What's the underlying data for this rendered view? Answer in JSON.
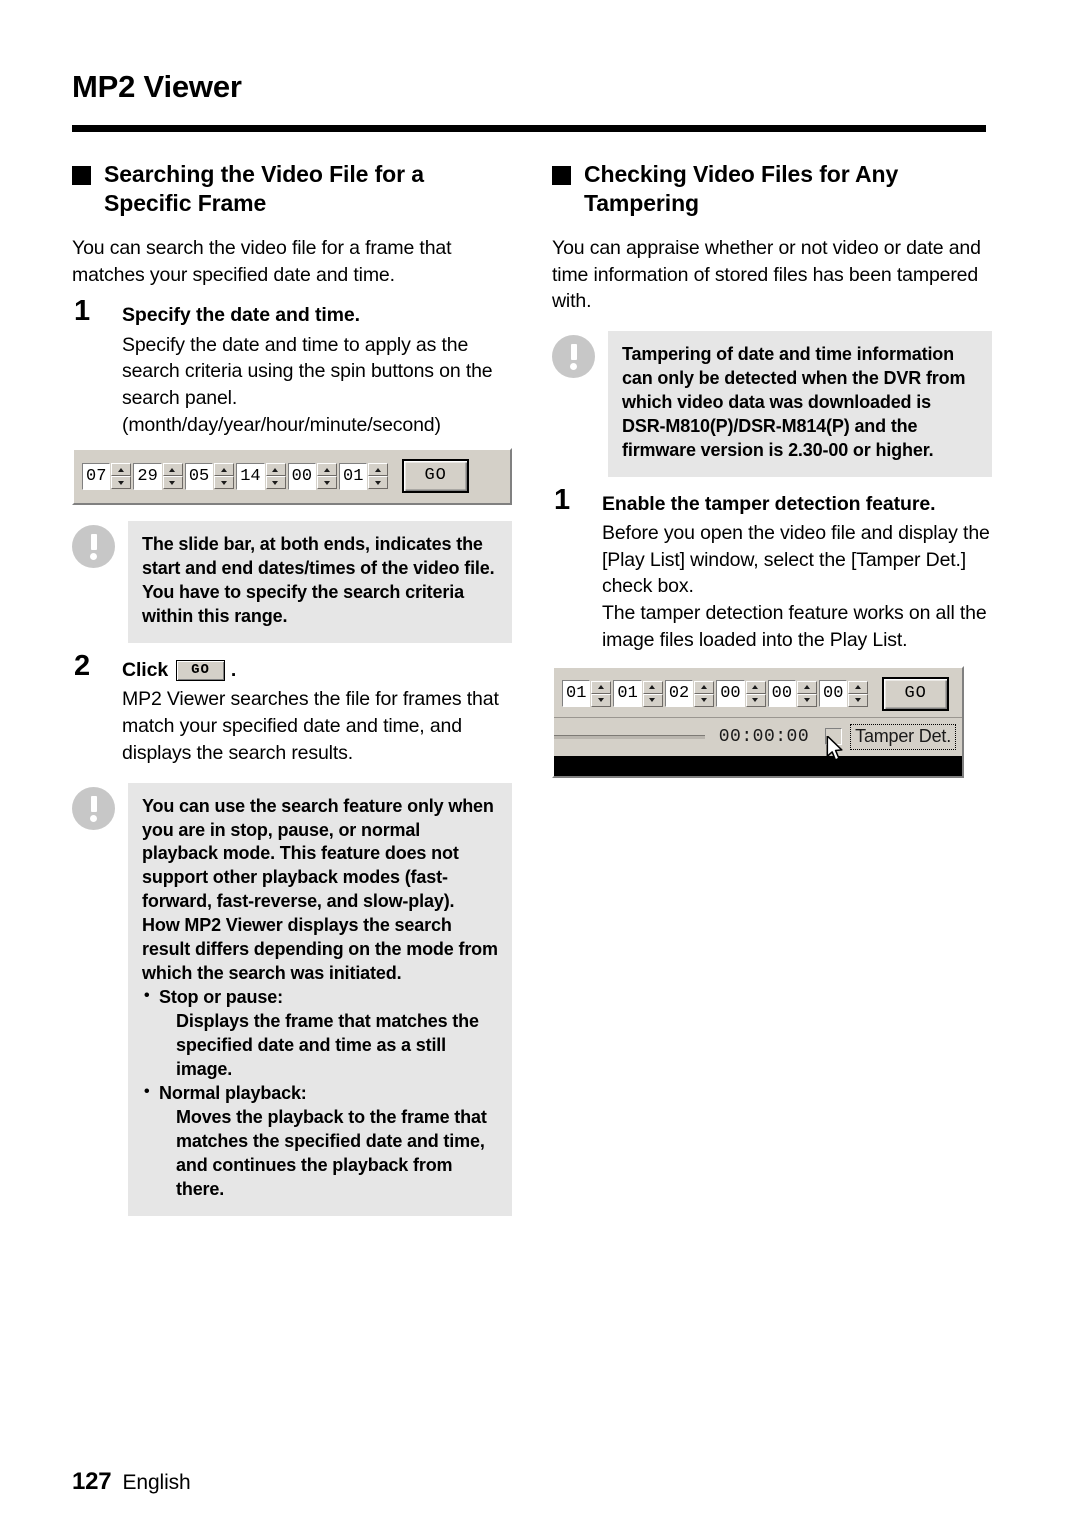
{
  "header": {
    "title": "MP2 Viewer"
  },
  "left_column": {
    "section_title": "Searching the Video File for a Specific Frame",
    "intro": "You can search the video file for a frame that matches your specified date and time.",
    "step1": {
      "number": "1",
      "title": "Specify the date and time.",
      "body": "Specify the date and time to apply as the search criteria using the spin buttons on the search panel. (month/day/year/hour/minute/second)"
    },
    "search_panel": {
      "spinners": [
        {
          "label": "month",
          "value": "07"
        },
        {
          "label": "day",
          "value": "29"
        },
        {
          "label": "year",
          "value": "05"
        },
        {
          "label": "hour",
          "value": "14"
        },
        {
          "label": "minute",
          "value": "00"
        },
        {
          "label": "second",
          "value": "01"
        }
      ],
      "go_label": "GO"
    },
    "note1": {
      "icon": "exclamation-circle-icon",
      "text": "The slide bar, at both ends, indicates the start and end dates/times of the video file. You have to specify the search criteria within this range."
    },
    "step2": {
      "number": "2",
      "title_prefix": "Click",
      "button_label": "GO",
      "title_suffix": ".",
      "body": "MP2 Viewer searches the file for frames that match your specified date and time, and displays the search results."
    },
    "note2": {
      "icon": "exclamation-circle-icon",
      "p1": "You can use the search feature only when you are in stop, pause, or normal playback mode. This feature does not support other playback modes (fast-forward, fast-reverse, and slow-play).",
      "p2": "How MP2 Viewer displays the search result differs depending on the mode from which the search was initiated.",
      "bullets": [
        {
          "term": "Stop or pause:",
          "detail": "Displays the frame that matches the specified date and time as a still image."
        },
        {
          "term": "Normal playback:",
          "detail": "Moves the playback to the frame that matches the specified date and time, and continues the playback from there."
        }
      ]
    }
  },
  "right_column": {
    "section_title": "Checking Video Files for Any Tampering",
    "intro": "You can appraise whether or not video or date and time information of stored files has been tampered with.",
    "note1": {
      "icon": "exclamation-circle-icon",
      "text": "Tampering of date and time information can only be detected when the DVR from which video data was downloaded is DSR-M810(P)/DSR-M814(P) and the firmware version is 2.30-00 or higher."
    },
    "step1": {
      "number": "1",
      "title": "Enable the tamper detection feature.",
      "body1": "Before you open the video file and display the [Play List] window, select the [Tamper Det.] check box.",
      "body2": "The tamper detection feature works on all the image files loaded into the Play List."
    },
    "tamper_panel": {
      "spinners": [
        {
          "label": "month",
          "value": "01"
        },
        {
          "label": "day",
          "value": "01"
        },
        {
          "label": "year",
          "value": "02"
        },
        {
          "label": "hour",
          "value": "00"
        },
        {
          "label": "minute",
          "value": "00"
        },
        {
          "label": "second",
          "value": "00"
        }
      ],
      "go_label": "GO",
      "time_readout": "00:00:00",
      "checkbox_label": "Tamper Det.",
      "cursor": "mouse-pointer-icon"
    }
  },
  "footer": {
    "page_number": "127",
    "language": "English"
  },
  "colors": {
    "panel_face": "#d4d0c8",
    "note_bg": "#e6e6e6",
    "note_icon": "#c7c7c7",
    "rule": "#000000"
  }
}
